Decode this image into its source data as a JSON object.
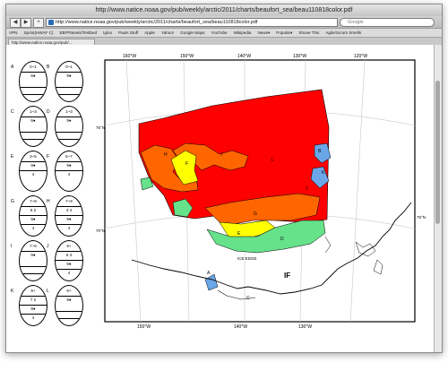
{
  "window": {
    "title": "http://www.natice.noaa.gov/pub/weekly/arctic/2011/charts/beaufort_sea/beau110818color.pdf"
  },
  "toolbar": {
    "back_label": "◀",
    "forward_label": "▶",
    "add_label": "+",
    "url": "http://www.natice.noaa.gov/pub/weekly/arctic/2011/charts/beaufort_sea/beau110818color.pdf",
    "search_placeholder": "Google"
  },
  "bookmarks": [
    "VPN",
    "Sprint(HWAF C)",
    "EBFPlanets/Testbed",
    "Igloo",
    "Pauls Stuff",
    "Apple",
    "Yahoo!",
    "Google Maps",
    "YouTube",
    "Wikipedia",
    "News▾",
    "Popular▾",
    "Shove This",
    "Agile/Scrum Smells"
  ],
  "tab": {
    "label": "http://www.natice.noaa.gov/pub/..."
  },
  "legend": [
    {
      "left": "A",
      "right": "B",
      "l": [
        "0~1",
        "6●"
      ],
      "r": [
        "0~1",
        "9●"
      ]
    },
    {
      "left": "C",
      "right": "D",
      "l": [
        "1~3",
        "6●"
      ],
      "r": [
        "1~3",
        "9●"
      ]
    },
    {
      "left": "E",
      "right": "F",
      "l": [
        "3~5",
        "9●",
        "4"
      ],
      "r": [
        "5~7",
        "9●",
        "4"
      ]
    },
    {
      "left": "G",
      "right": "H",
      "l": [
        "7~9",
        "6 2",
        "9●",
        "4"
      ],
      "r": [
        "7~9",
        "3 4",
        "9●",
        "4"
      ]
    },
    {
      "left": "I",
      "right": "J",
      "l": [
        "7~9",
        "9●"
      ],
      "r": [
        "9+",
        "6 3",
        "9●",
        "4"
      ]
    },
    {
      "left": "K",
      "right": "L",
      "l": [
        "9+",
        "7 2",
        "9●",
        "4"
      ],
      "r": [
        "9+",
        "9●"
      ]
    }
  ],
  "map": {
    "lon_labels_top": [
      "160°W",
      "150°W",
      "140°W",
      "130°W",
      "120°W"
    ],
    "lon_labels_bottom": [
      "150°W",
      "140°W",
      "130°W"
    ],
    "lat_labels_left": [
      "75°N",
      "70°N"
    ],
    "lat_labels_right": [
      "75°N"
    ],
    "region_labels": [
      "A",
      "B",
      "C",
      "D",
      "E",
      "F",
      "G",
      "H",
      "I",
      "J",
      "K",
      "L"
    ],
    "ice_edge_label": "ICE EDGE",
    "if_label": "IF",
    "colors": {
      "red": "#ff0000",
      "orange": "#ff6600",
      "yellow": "#ffff00",
      "green": "#66e28a",
      "blue": "#6aa6e8"
    }
  }
}
